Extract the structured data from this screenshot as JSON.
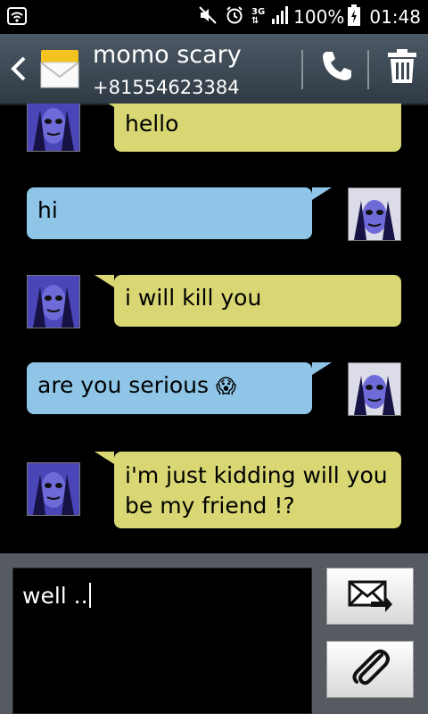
{
  "status_bar": {
    "battery": "100%",
    "time": "01:48",
    "network": "3G",
    "icons": [
      "wifi-icon",
      "mute-icon",
      "alarm-icon",
      "network-3g-icon",
      "signal-icon",
      "battery-charging-icon"
    ]
  },
  "header": {
    "contact_name": "momo scary",
    "phone_number": "+81554623384",
    "icons": [
      "back-icon",
      "message-envelope-icon",
      "call-icon",
      "trash-icon"
    ]
  },
  "messages": [
    {
      "direction": "incoming",
      "text": "hello"
    },
    {
      "direction": "outgoing",
      "text": "hi"
    },
    {
      "direction": "incoming",
      "text": "i will kill you"
    },
    {
      "direction": "outgoing",
      "text": "are you serious",
      "emoji": "😱"
    },
    {
      "direction": "incoming",
      "text": "i'm just kidding will you be my friend !?"
    }
  ],
  "composer": {
    "input_value": "well ..",
    "icons": [
      "send-icon",
      "attach-icon"
    ]
  },
  "colors": {
    "incoming_bubble": "#d8d774",
    "outgoing_bubble": "#8fc6e8",
    "header_bg": "#3d4953",
    "composer_bg": "#555b61"
  }
}
